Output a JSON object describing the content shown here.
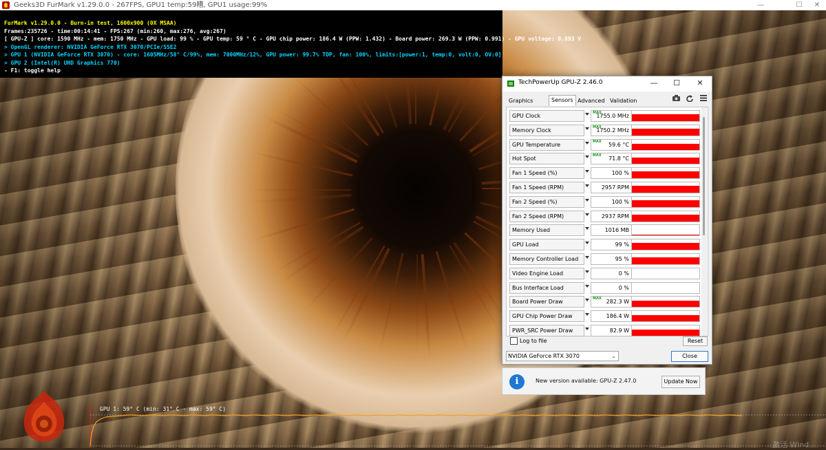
{
  "window": {
    "title": "Geeks3D FurMark v1.29.0.0 - 267FPS, GPU1 temp:59糟, GPU1 usage:99%",
    "minimize_glyph": "—",
    "maximize_glyph": "☐",
    "close_glyph": "✕"
  },
  "hud": {
    "line1": "FurMark v1.29.0.0 - Burn-in test, 1600x900 (0X MSAA)",
    "line2": "Frames:235726 - time:00:14:41 - FPS:267 (min:260, max:276, avg:267)",
    "line3": "[ GPU-Z ] core: 1590 MHz - mem: 1750 MHz - GPU load: 99 % - GPU temp: 59 ° C - GPU chip power: 186.4 W (PPW: 1.432) - Board power: 269.3 W (PPW: 0.991) - GPU voltage: 0.893 V",
    "line4": "> OpenGL renderer: NVIDIA GeForce RTX 3070/PCIe/SSE2",
    "line5": "> GPU 1 (NVIDIA GeForce RTX 3070) - core: 1605MHz/58° C/99%, mem: 7000MHz/12%, GPU power: 99.7% TDP, fan: 100%, limits:[power:1, temp:0, volt:0, OV:0]",
    "line6": "> GPU 2 (Intel(R) UHD Graphics 770)",
    "line7": "- F1: toggle help",
    "colors": {
      "line1": "#ffff00",
      "line2": "#ffffff",
      "line3": "#ffffff",
      "line4": "#00d7ff",
      "line5": "#00d7ff",
      "line6": "#00d7ff",
      "line7": "#ffffff"
    }
  },
  "temp_graph": {
    "label": "GPU 1: 59° C (min: 31° C - max: 59° C)",
    "line_color": "#f0a020"
  },
  "watermark": "激活 Wind",
  "gpuz": {
    "title": "TechPowerUp GPU-Z 2.46.0",
    "tabs": [
      "Graphics Card",
      "Sensors",
      "Advanced",
      "Validation"
    ],
    "active_tab": "Sensors",
    "toolbar_icons": [
      "camera-icon",
      "refresh-icon",
      "menu-icon"
    ],
    "max_badge": "MAX",
    "sensors": [
      {
        "name": "GPU Clock",
        "value": "1755.0 MHz",
        "max": true,
        "level": 0.95
      },
      {
        "name": "Memory Clock",
        "value": "1750.2 MHz",
        "max": true,
        "level": 0.95
      },
      {
        "name": "GPU Temperature",
        "value": "59.6 °C",
        "max": true,
        "level": 0.92
      },
      {
        "name": "Hot Spot",
        "value": "71.8 °C",
        "max": true,
        "level": 0.92
      },
      {
        "name": "Fan 1 Speed (%)",
        "value": "100 %",
        "max": false,
        "level": 1.0
      },
      {
        "name": "Fan 1 Speed (RPM)",
        "value": "2957 RPM",
        "max": false,
        "level": 1.0
      },
      {
        "name": "Fan 2 Speed (%)",
        "value": "100 %",
        "max": false,
        "level": 1.0
      },
      {
        "name": "Fan 2 Speed (RPM)",
        "value": "2937 RPM",
        "max": false,
        "level": 1.0
      },
      {
        "name": "Memory Used",
        "value": "1016 MB",
        "max": false,
        "level": 0.12
      },
      {
        "name": "GPU Load",
        "value": "99 %",
        "max": false,
        "level": 0.99
      },
      {
        "name": "Memory Controller Load",
        "value": "95 %",
        "max": false,
        "level": 0.95
      },
      {
        "name": "Video Engine Load",
        "value": "0 %",
        "max": false,
        "level": 0
      },
      {
        "name": "Bus Interface Load",
        "value": "0 %",
        "max": false,
        "level": 0
      },
      {
        "name": "Board Power Draw",
        "value": "282.3 W",
        "max": true,
        "level": 0.9
      },
      {
        "name": "GPU Chip Power Draw",
        "value": "186.4 W",
        "max": false,
        "level": 0.9
      },
      {
        "name": "PWR_SRC Power Draw",
        "value": "82.9 W",
        "max": false,
        "level": 0.9
      }
    ],
    "log_to_file": "Log to file",
    "reset": "Reset",
    "gpu_select": "NVIDIA GeForce RTX 3070",
    "close": "Close",
    "bar_color": "#ff0000"
  },
  "notice": {
    "message": "New version available: GPU-Z 2.47.0",
    "update_button": "Update Now"
  }
}
